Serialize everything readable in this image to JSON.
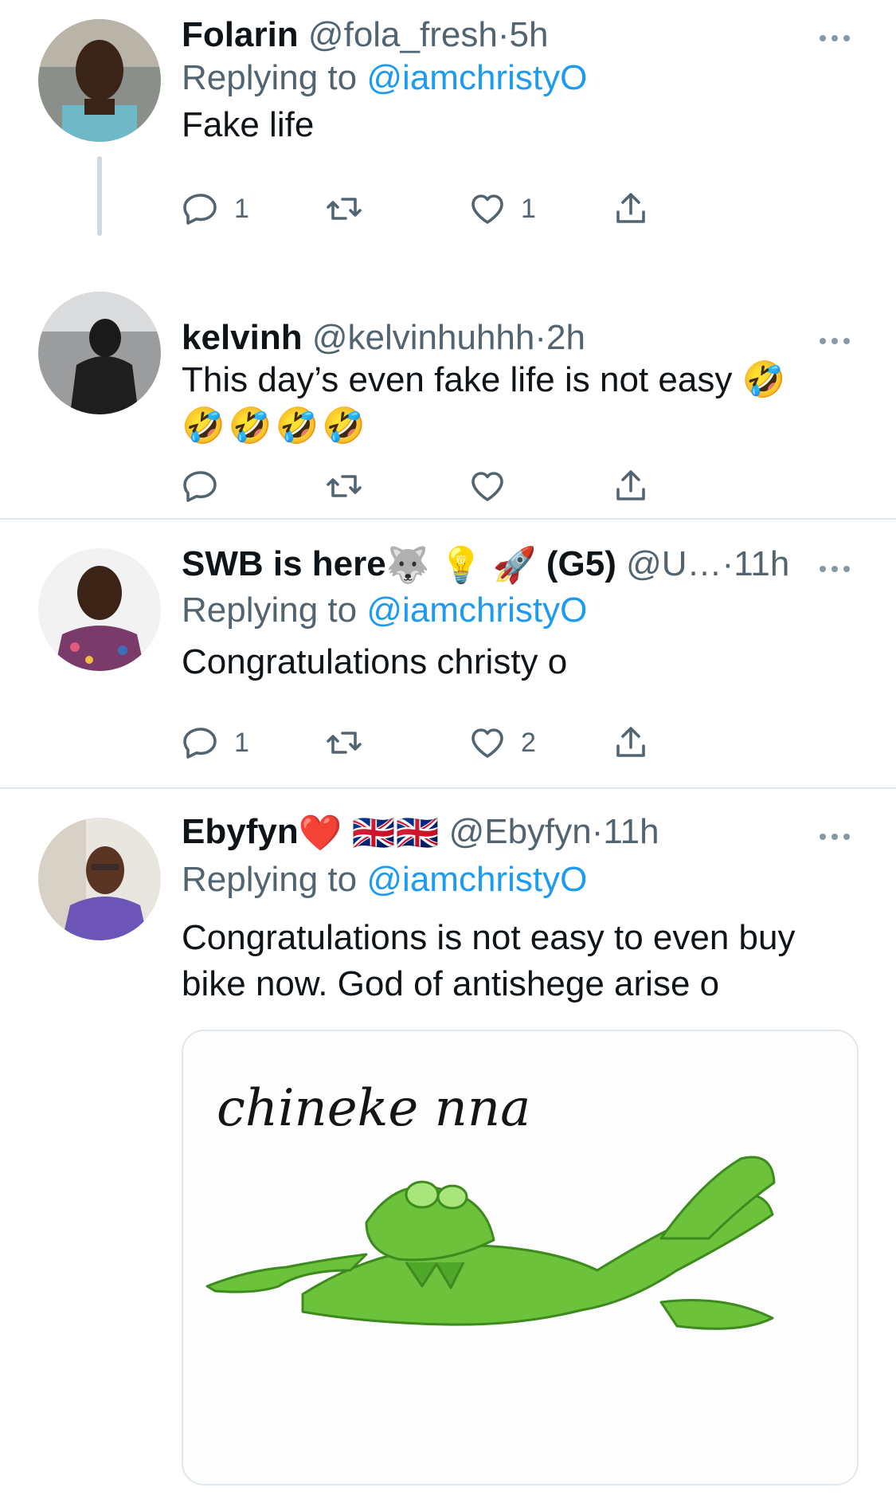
{
  "tweets": [
    {
      "name": "Folarin",
      "handle": "@fola_fresh",
      "separator": "·",
      "time": "5h",
      "replying_prefix": "Replying to",
      "replying_to": "@iamchristyO",
      "text": "Fake life",
      "reply_count": "1",
      "like_count": "1"
    },
    {
      "name": "kelvinh",
      "handle": "@kelvinhuhhh",
      "separator": "·",
      "time": "2h",
      "text": "This day’s even fake life is not easy 🤣",
      "text_line2": "🤣🤣🤣🤣"
    },
    {
      "name": "SWB is here",
      "name_suffix": "(G5)",
      "handle": "@U…",
      "separator": "·",
      "time": "11h",
      "replying_prefix": "Replying to",
      "replying_to": "@iamchristyO",
      "text": "Congratulations christy o",
      "reply_count": "1",
      "like_count": "2"
    },
    {
      "name": "Ebyfyn",
      "handle": "@Ebyfyn",
      "separator": "·",
      "time": "11h",
      "replying_prefix": "Replying to",
      "replying_to": "@iamchristyO",
      "text": "Congratulations is not easy to even buy",
      "text_line2": "bike now. God of antishege arise o",
      "media_caption": "chineke nna"
    }
  ],
  "colors": {
    "text": "#0f1419",
    "secondary": "#536471",
    "link": "#1d9bf0",
    "divider": "#e1e8ed",
    "heart_red": "#e0245e",
    "kermit_green": "#6cc23a"
  },
  "icons": {
    "reply": "reply-icon",
    "retweet": "retweet-icon",
    "like": "heart-icon",
    "share": "share-icon",
    "more": "more-icon"
  }
}
